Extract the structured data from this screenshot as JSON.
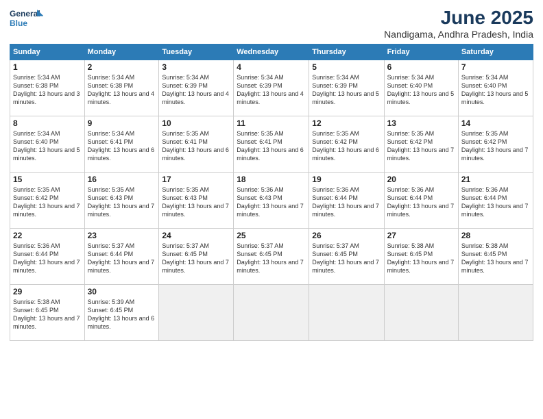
{
  "logo": {
    "line1": "General",
    "line2": "Blue"
  },
  "title": "June 2025",
  "subtitle": "Nandigama, Andhra Pradesh, India",
  "days_of_week": [
    "Sunday",
    "Monday",
    "Tuesday",
    "Wednesday",
    "Thursday",
    "Friday",
    "Saturday"
  ],
  "weeks": [
    [
      {
        "day": "1",
        "sunrise": "5:34 AM",
        "sunset": "6:38 PM",
        "daylight": "13 hours and 3 minutes."
      },
      {
        "day": "2",
        "sunrise": "5:34 AM",
        "sunset": "6:38 PM",
        "daylight": "13 hours and 4 minutes."
      },
      {
        "day": "3",
        "sunrise": "5:34 AM",
        "sunset": "6:39 PM",
        "daylight": "13 hours and 4 minutes."
      },
      {
        "day": "4",
        "sunrise": "5:34 AM",
        "sunset": "6:39 PM",
        "daylight": "13 hours and 4 minutes."
      },
      {
        "day": "5",
        "sunrise": "5:34 AM",
        "sunset": "6:39 PM",
        "daylight": "13 hours and 5 minutes."
      },
      {
        "day": "6",
        "sunrise": "5:34 AM",
        "sunset": "6:40 PM",
        "daylight": "13 hours and 5 minutes."
      },
      {
        "day": "7",
        "sunrise": "5:34 AM",
        "sunset": "6:40 PM",
        "daylight": "13 hours and 5 minutes."
      }
    ],
    [
      {
        "day": "8",
        "sunrise": "5:34 AM",
        "sunset": "6:40 PM",
        "daylight": "13 hours and 5 minutes."
      },
      {
        "day": "9",
        "sunrise": "5:34 AM",
        "sunset": "6:41 PM",
        "daylight": "13 hours and 6 minutes."
      },
      {
        "day": "10",
        "sunrise": "5:35 AM",
        "sunset": "6:41 PM",
        "daylight": "13 hours and 6 minutes."
      },
      {
        "day": "11",
        "sunrise": "5:35 AM",
        "sunset": "6:41 PM",
        "daylight": "13 hours and 6 minutes."
      },
      {
        "day": "12",
        "sunrise": "5:35 AM",
        "sunset": "6:42 PM",
        "daylight": "13 hours and 6 minutes."
      },
      {
        "day": "13",
        "sunrise": "5:35 AM",
        "sunset": "6:42 PM",
        "daylight": "13 hours and 7 minutes."
      },
      {
        "day": "14",
        "sunrise": "5:35 AM",
        "sunset": "6:42 PM",
        "daylight": "13 hours and 7 minutes."
      }
    ],
    [
      {
        "day": "15",
        "sunrise": "5:35 AM",
        "sunset": "6:42 PM",
        "daylight": "13 hours and 7 minutes."
      },
      {
        "day": "16",
        "sunrise": "5:35 AM",
        "sunset": "6:43 PM",
        "daylight": "13 hours and 7 minutes."
      },
      {
        "day": "17",
        "sunrise": "5:35 AM",
        "sunset": "6:43 PM",
        "daylight": "13 hours and 7 minutes."
      },
      {
        "day": "18",
        "sunrise": "5:36 AM",
        "sunset": "6:43 PM",
        "daylight": "13 hours and 7 minutes."
      },
      {
        "day": "19",
        "sunrise": "5:36 AM",
        "sunset": "6:44 PM",
        "daylight": "13 hours and 7 minutes."
      },
      {
        "day": "20",
        "sunrise": "5:36 AM",
        "sunset": "6:44 PM",
        "daylight": "13 hours and 7 minutes."
      },
      {
        "day": "21",
        "sunrise": "5:36 AM",
        "sunset": "6:44 PM",
        "daylight": "13 hours and 7 minutes."
      }
    ],
    [
      {
        "day": "22",
        "sunrise": "5:36 AM",
        "sunset": "6:44 PM",
        "daylight": "13 hours and 7 minutes."
      },
      {
        "day": "23",
        "sunrise": "5:37 AM",
        "sunset": "6:44 PM",
        "daylight": "13 hours and 7 minutes."
      },
      {
        "day": "24",
        "sunrise": "5:37 AM",
        "sunset": "6:45 PM",
        "daylight": "13 hours and 7 minutes."
      },
      {
        "day": "25",
        "sunrise": "5:37 AM",
        "sunset": "6:45 PM",
        "daylight": "13 hours and 7 minutes."
      },
      {
        "day": "26",
        "sunrise": "5:37 AM",
        "sunset": "6:45 PM",
        "daylight": "13 hours and 7 minutes."
      },
      {
        "day": "27",
        "sunrise": "5:38 AM",
        "sunset": "6:45 PM",
        "daylight": "13 hours and 7 minutes."
      },
      {
        "day": "28",
        "sunrise": "5:38 AM",
        "sunset": "6:45 PM",
        "daylight": "13 hours and 7 minutes."
      }
    ],
    [
      {
        "day": "29",
        "sunrise": "5:38 AM",
        "sunset": "6:45 PM",
        "daylight": "13 hours and 7 minutes."
      },
      {
        "day": "30",
        "sunrise": "5:39 AM",
        "sunset": "6:45 PM",
        "daylight": "13 hours and 6 minutes."
      },
      null,
      null,
      null,
      null,
      null
    ]
  ]
}
